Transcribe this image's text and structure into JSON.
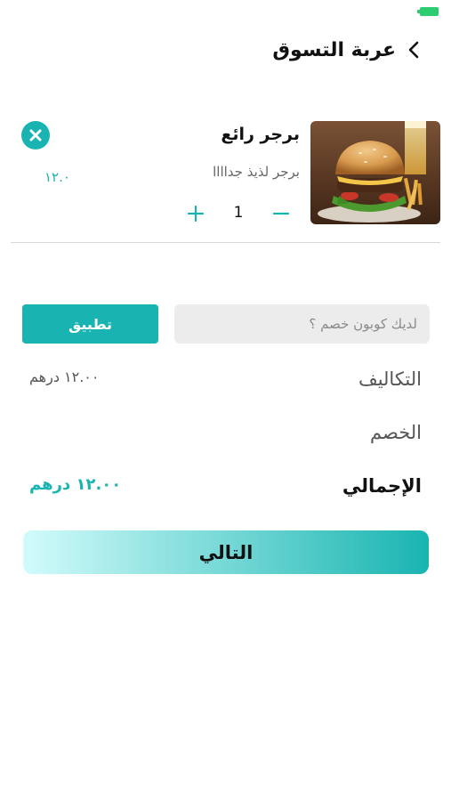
{
  "header": {
    "title": "عربة التسوق",
    "back_icon": "chevron-left-icon"
  },
  "cart_item": {
    "name": "برجر رائع",
    "description": "برجر لذيذ جداااا",
    "price": "١٢.٠",
    "quantity": "1",
    "remove_icon": "close-circle-icon",
    "plus_icon": "plus-icon",
    "minus_icon": "minus-icon"
  },
  "coupon": {
    "placeholder": "لديك كوبون خصم ؟",
    "value": "",
    "apply_label": "تطبيق"
  },
  "summary": {
    "costs_label": "التكاليف",
    "costs_value": "١٢.٠٠ درهم",
    "discount_label": "الخصم",
    "discount_value": "",
    "total_label": "الإجمالي",
    "total_value": "١٢.٠٠ درهم"
  },
  "next_label": "التالي",
  "colors": {
    "accent": "#19b4b1",
    "gradient_start": "#d2fbfb",
    "input_bg": "#ececec",
    "battery": "#2ecc71"
  }
}
